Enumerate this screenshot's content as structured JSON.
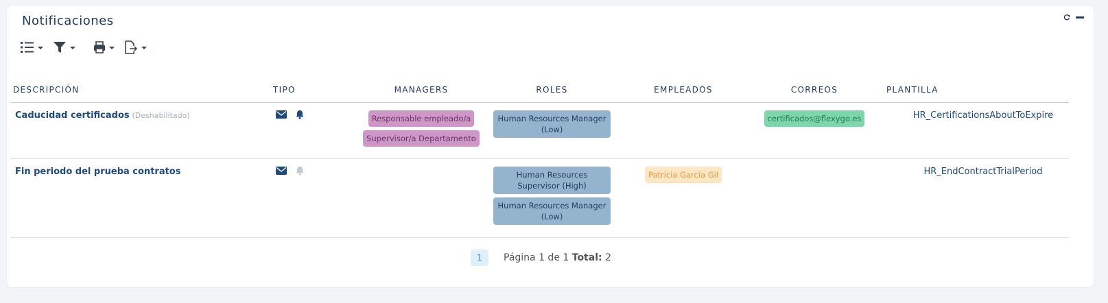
{
  "panel": {
    "title": "Notificaciones",
    "controls": {
      "refresh_icon": "refresh-icon",
      "minimize_icon": "minimize-icon"
    }
  },
  "toolbar": {
    "items": [
      {
        "icon": "list-view-icon"
      },
      {
        "icon": "filter-icon"
      },
      {
        "icon": "print-icon"
      },
      {
        "icon": "export-icon"
      }
    ]
  },
  "columns": {
    "descripcion": "DESCRIPCIÓN",
    "tipo": "TIPO",
    "managers": "MANAGERS",
    "roles": "ROLES",
    "empleados": "EMPLEADOS",
    "correos": "CORREOS",
    "plantilla": "PLANTILLA"
  },
  "rows": [
    {
      "descripcion": "Caducidad certificados",
      "estado": "(Deshabilitado)",
      "tipo": {
        "email": true,
        "bell_active": true
      },
      "managers": [
        "Responsable empleado/a",
        "Supervisor/a Departamento"
      ],
      "roles": [
        "Human Resources Manager (Low)"
      ],
      "empleados": [],
      "correos": [
        "certificados@flexygo.es"
      ],
      "plantilla": "HR_CertificationsAboutToExpire"
    },
    {
      "descripcion": "Fin periodo del prueba contratos",
      "estado": "",
      "tipo": {
        "email": true,
        "bell_active": false
      },
      "managers": [],
      "roles": [
        "Human Resources Supervisor (High)",
        "Human Resources Manager (Low)"
      ],
      "empleados": [
        "Patricia García Gil"
      ],
      "correos": [],
      "plantilla": "HR_EndContractTrialPeriod"
    }
  ],
  "pagination": {
    "current_page": "1",
    "page_text": "Página 1 de 1",
    "total_label": "Total:",
    "total_value": "2"
  },
  "colors": {
    "manager_badge": "#cf97c8",
    "role_badge": "#94b4cd",
    "employee_badge": "#fde6c4",
    "email_badge": "#7ed6ab",
    "accent": "#1f3a5f"
  }
}
